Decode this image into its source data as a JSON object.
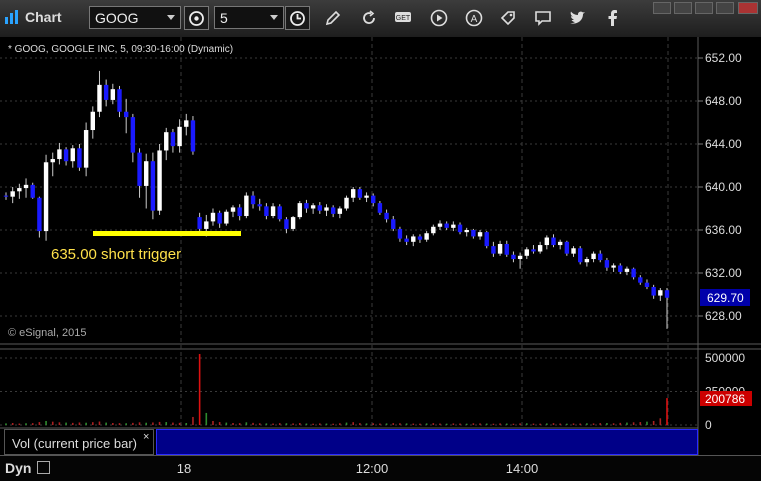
{
  "toolbar": {
    "app_title": "Chart",
    "symbol_value": "GOOG",
    "interval_value": "5",
    "icons": [
      "link-settings-icon",
      "clock-icon",
      "draw-pencil-icon",
      "refresh-icon",
      "get-quote-icon",
      "play-icon",
      "alert-icon",
      "tag-icon",
      "chat-icon",
      "twitter-icon",
      "facebook-icon"
    ]
  },
  "chart_header": "* GOOG, GOOGLE INC, 5, 09:30-16:00 (Dynamic)",
  "copyright": "© eSignal, 2015",
  "annotation": {
    "text": "635.00 short trigger",
    "color": "#ffff00"
  },
  "price_axis": {
    "ticks": [
      "652.00",
      "648.00",
      "644.00",
      "640.00",
      "636.00",
      "632.00",
      "628.00"
    ],
    "last_price": "629.70"
  },
  "volume_axis": {
    "ticks": [
      "500000",
      "250000",
      "0"
    ],
    "last_volume": "200786"
  },
  "volume_pane_label": "Vol (current price bar)",
  "volume_pane_close": "×",
  "status": {
    "dyn_label": "Dyn"
  },
  "time_axis": {
    "labels": [
      "18",
      "12:00",
      "14:00"
    ]
  },
  "colors": {
    "up": "#ffffff",
    "down": "#1a1aff",
    "trigger": "#ffff00",
    "last_price_bg": "#0000aa",
    "last_volume_bg": "#cc0000"
  },
  "chart_data": {
    "type": "candlestick",
    "title": "GOOG, GOOGLE INC, 5, 09:30-16:00 (Dynamic)",
    "ylim": [
      626,
      653
    ],
    "ohlc": [
      [
        639.2,
        639.5,
        638.8,
        639.1
      ],
      [
        639.1,
        640.0,
        638.5,
        639.6
      ],
      [
        639.6,
        640.3,
        638.9,
        639.9
      ],
      [
        639.9,
        640.8,
        639.0,
        640.2
      ],
      [
        640.2,
        640.4,
        638.9,
        639.0
      ],
      [
        639.0,
        639.1,
        635.3,
        635.9
      ],
      [
        635.9,
        643.0,
        635.0,
        642.3
      ],
      [
        642.3,
        643.2,
        641.0,
        642.6
      ],
      [
        642.6,
        644.1,
        642.1,
        643.5
      ],
      [
        643.5,
        643.7,
        642.0,
        642.4
      ],
      [
        642.4,
        643.9,
        641.8,
        643.6
      ],
      [
        643.6,
        644.0,
        641.5,
        641.8
      ],
      [
        641.8,
        646.0,
        641.0,
        645.3
      ],
      [
        645.3,
        647.5,
        644.5,
        647.0
      ],
      [
        647.0,
        650.8,
        646.5,
        649.5
      ],
      [
        649.5,
        650.0,
        647.5,
        648.1
      ],
      [
        648.1,
        649.6,
        647.7,
        649.1
      ],
      [
        649.1,
        649.4,
        646.5,
        647.0
      ],
      [
        647.0,
        648.2,
        645.0,
        646.5
      ],
      [
        646.5,
        646.8,
        642.3,
        643.2
      ],
      [
        643.2,
        643.6,
        639.0,
        640.1
      ],
      [
        640.1,
        643.1,
        638.0,
        642.4
      ],
      [
        642.4,
        643.2,
        637.0,
        637.8
      ],
      [
        637.8,
        644.0,
        637.4,
        643.4
      ],
      [
        643.4,
        645.5,
        642.5,
        645.1
      ],
      [
        645.1,
        645.4,
        643.2,
        643.8
      ],
      [
        643.8,
        646.3,
        643.2,
        645.6
      ],
      [
        645.6,
        646.8,
        644.8,
        646.2
      ],
      [
        646.2,
        646.6,
        643.0,
        643.3
      ],
      [
        637.2,
        637.6,
        635.5,
        636.1
      ],
      [
        636.1,
        637.4,
        635.4,
        636.8
      ],
      [
        636.8,
        638.0,
        636.4,
        637.6
      ],
      [
        637.6,
        637.8,
        636.2,
        636.6
      ],
      [
        636.6,
        637.9,
        636.4,
        637.7
      ],
      [
        637.7,
        638.3,
        637.2,
        638.1
      ],
      [
        638.1,
        638.4,
        636.9,
        637.3
      ],
      [
        637.3,
        639.5,
        637.1,
        639.2
      ],
      [
        639.2,
        639.6,
        638.0,
        638.4
      ],
      [
        638.4,
        638.9,
        637.8,
        638.2
      ],
      [
        638.2,
        638.5,
        637.0,
        637.3
      ],
      [
        637.3,
        638.5,
        637.1,
        638.2
      ],
      [
        638.2,
        638.4,
        636.8,
        637.0
      ],
      [
        637.0,
        637.2,
        635.7,
        636.1
      ],
      [
        636.1,
        637.3,
        635.9,
        637.2
      ],
      [
        637.2,
        638.7,
        637.0,
        638.5
      ],
      [
        638.5,
        638.8,
        637.6,
        638.0
      ],
      [
        638.0,
        638.5,
        637.5,
        638.3
      ],
      [
        638.3,
        638.6,
        637.5,
        637.8
      ],
      [
        637.8,
        638.4,
        637.3,
        638.1
      ],
      [
        638.1,
        638.3,
        637.2,
        637.5
      ],
      [
        637.5,
        638.2,
        637.1,
        638.0
      ],
      [
        638.0,
        639.2,
        637.8,
        639.0
      ],
      [
        639.0,
        640.0,
        638.6,
        639.8
      ],
      [
        639.8,
        640.0,
        638.8,
        639.0
      ],
      [
        639.0,
        639.5,
        638.6,
        639.2
      ],
      [
        639.2,
        639.4,
        638.2,
        638.5
      ],
      [
        638.5,
        638.7,
        637.4,
        637.6
      ],
      [
        637.6,
        637.9,
        636.7,
        637.0
      ],
      [
        637.0,
        637.3,
        635.9,
        636.1
      ],
      [
        636.1,
        636.3,
        634.9,
        635.2
      ],
      [
        635.2,
        635.5,
        634.6,
        634.9
      ],
      [
        634.9,
        635.6,
        634.5,
        635.4
      ],
      [
        635.4,
        635.6,
        634.8,
        635.1
      ],
      [
        635.1,
        635.9,
        634.9,
        635.7
      ],
      [
        635.7,
        636.5,
        635.5,
        636.3
      ],
      [
        636.3,
        636.9,
        636.0,
        636.6
      ],
      [
        636.6,
        636.8,
        636.0,
        636.2
      ],
      [
        636.2,
        636.8,
        635.9,
        636.5
      ],
      [
        636.5,
        636.7,
        635.6,
        635.8
      ],
      [
        635.8,
        636.2,
        635.4,
        636.0
      ],
      [
        636.0,
        636.1,
        635.2,
        635.4
      ],
      [
        635.4,
        636.0,
        635.1,
        635.8
      ],
      [
        635.8,
        635.9,
        634.3,
        634.5
      ],
      [
        634.5,
        634.9,
        633.5,
        633.8
      ],
      [
        633.8,
        635.0,
        633.6,
        634.7
      ],
      [
        634.7,
        635.0,
        633.5,
        633.7
      ],
      [
        633.7,
        634.0,
        633.0,
        633.3
      ],
      [
        633.3,
        633.9,
        632.4,
        633.6
      ],
      [
        633.6,
        634.4,
        633.3,
        634.2
      ],
      [
        634.2,
        634.6,
        633.8,
        634.0
      ],
      [
        634.0,
        634.9,
        633.8,
        634.6
      ],
      [
        634.6,
        635.5,
        634.2,
        635.3
      ],
      [
        635.3,
        635.6,
        634.4,
        634.6
      ],
      [
        634.6,
        635.1,
        634.2,
        634.9
      ],
      [
        634.9,
        635.0,
        633.6,
        633.8
      ],
      [
        633.8,
        634.5,
        633.5,
        634.3
      ],
      [
        634.3,
        634.5,
        632.8,
        633.0
      ],
      [
        633.0,
        633.5,
        632.6,
        633.3
      ],
      [
        633.3,
        634.0,
        633.0,
        633.8
      ],
      [
        633.8,
        634.1,
        633.0,
        633.2
      ],
      [
        633.2,
        633.4,
        632.2,
        632.5
      ],
      [
        632.5,
        632.9,
        632.1,
        632.7
      ],
      [
        632.7,
        632.9,
        631.9,
        632.1
      ],
      [
        632.1,
        632.6,
        631.8,
        632.4
      ],
      [
        632.4,
        632.5,
        631.4,
        631.6
      ],
      [
        631.6,
        631.8,
        630.9,
        631.1
      ],
      [
        631.1,
        631.4,
        630.5,
        630.7
      ],
      [
        630.7,
        630.9,
        629.6,
        629.9
      ],
      [
        629.9,
        630.6,
        629.4,
        630.4
      ],
      [
        630.4,
        630.6,
        626.8,
        629.7
      ]
    ],
    "volume": [
      12000,
      15000,
      11000,
      13000,
      14000,
      22000,
      30000,
      25000,
      20000,
      18000,
      16000,
      19000,
      17000,
      21000,
      26000,
      18000,
      15000,
      14000,
      13000,
      16000,
      20000,
      17000,
      19000,
      23000,
      22000,
      18000,
      16000,
      15000,
      60000,
      530000,
      90000,
      30000,
      22000,
      18000,
      15000,
      14000,
      20000,
      16000,
      13000,
      12000,
      11000,
      14000,
      13000,
      12000,
      15000,
      11000,
      10000,
      12000,
      11000,
      10000,
      13000,
      18000,
      21000,
      14000,
      12000,
      13000,
      11000,
      12000,
      14000,
      13000,
      12000,
      11000,
      10000,
      12000,
      14000,
      11000,
      10000,
      12000,
      11000,
      10000,
      13000,
      12000,
      11000,
      10000,
      12000,
      11000,
      10000,
      12000,
      13000,
      11000,
      10000,
      12000,
      14000,
      11000,
      10000,
      12000,
      11000,
      13000,
      12000,
      14000,
      15000,
      13000,
      16000,
      18000,
      20000,
      22000,
      25000,
      30000,
      50000,
      200786
    ],
    "trigger_level": 635.0,
    "last_price": 629.7,
    "last_volume": 200786,
    "volume_ylim": [
      0,
      550000
    ]
  }
}
